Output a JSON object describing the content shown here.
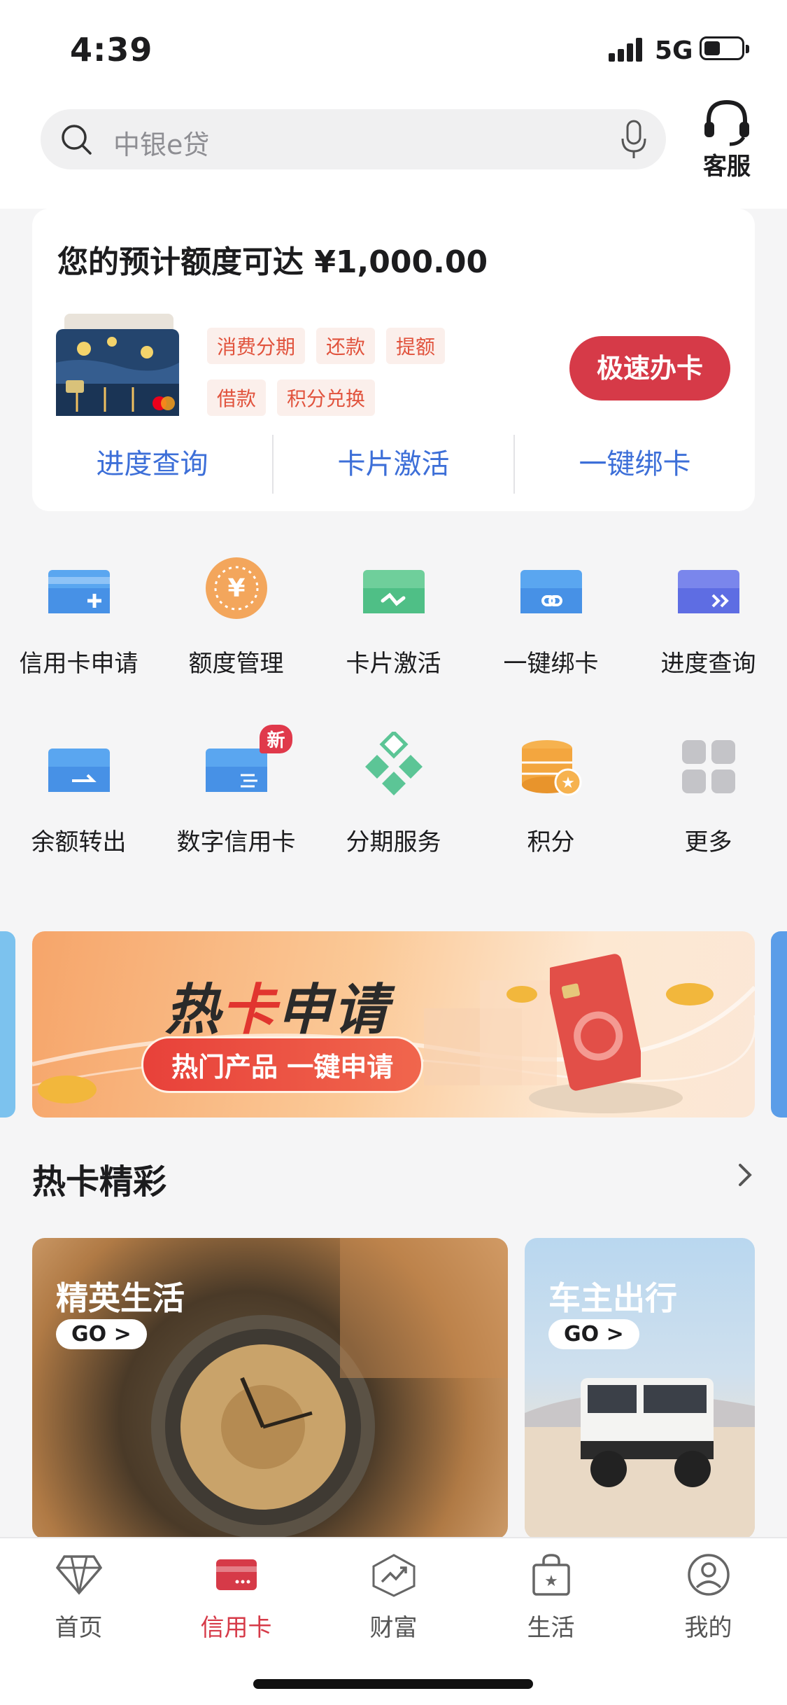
{
  "status_bar": {
    "time": "4:39",
    "network": "5G",
    "battery_level": 0.4
  },
  "search": {
    "placeholder": "中银e贷"
  },
  "customer_service": {
    "label": "客服"
  },
  "limit_card": {
    "title": "您的预计额度可达 ¥1,000.00",
    "tags": [
      "消费分期",
      "还款",
      "提额",
      "借款",
      "积分兑换"
    ],
    "apply_button": "极速办卡",
    "quick_links": [
      "进度查询",
      "卡片激活",
      "一键绑卡"
    ]
  },
  "services": [
    {
      "label": "信用卡申请",
      "icon": "card-add-icon"
    },
    {
      "label": "额度管理",
      "icon": "yen-coin-icon"
    },
    {
      "label": "卡片激活",
      "icon": "card-activate-icon"
    },
    {
      "label": "一键绑卡",
      "icon": "card-link-icon"
    },
    {
      "label": "进度查询",
      "icon": "card-progress-icon"
    },
    {
      "label": "余额转出",
      "icon": "card-transfer-icon"
    },
    {
      "label": "数字信用卡",
      "icon": "digital-card-icon",
      "badge": "新"
    },
    {
      "label": "分期服务",
      "icon": "diamond-grid-icon"
    },
    {
      "label": "积分",
      "icon": "points-stack-icon"
    },
    {
      "label": "更多",
      "icon": "more-grid-icon"
    }
  ],
  "banner": {
    "title_a": "热",
    "title_b": "卡",
    "title_c": "申请",
    "subtitle": "热门产品 一键申请"
  },
  "hot_section": {
    "title": "热卡精彩"
  },
  "promos": [
    {
      "title": "精英生活",
      "go": "GO >"
    },
    {
      "title": "车主出行",
      "go": "GO >"
    }
  ],
  "tabbar": [
    {
      "label": "首页",
      "icon": "diamond-icon"
    },
    {
      "label": "信用卡",
      "icon": "credit-card-icon",
      "active": true
    },
    {
      "label": "财富",
      "icon": "wealth-chart-icon"
    },
    {
      "label": "生活",
      "icon": "shopping-bag-icon"
    },
    {
      "label": "我的",
      "icon": "profile-icon"
    }
  ],
  "colors": {
    "brand_red": "#d63a48",
    "link_blue": "#3d6fd8",
    "tag_text": "#e1533d"
  }
}
